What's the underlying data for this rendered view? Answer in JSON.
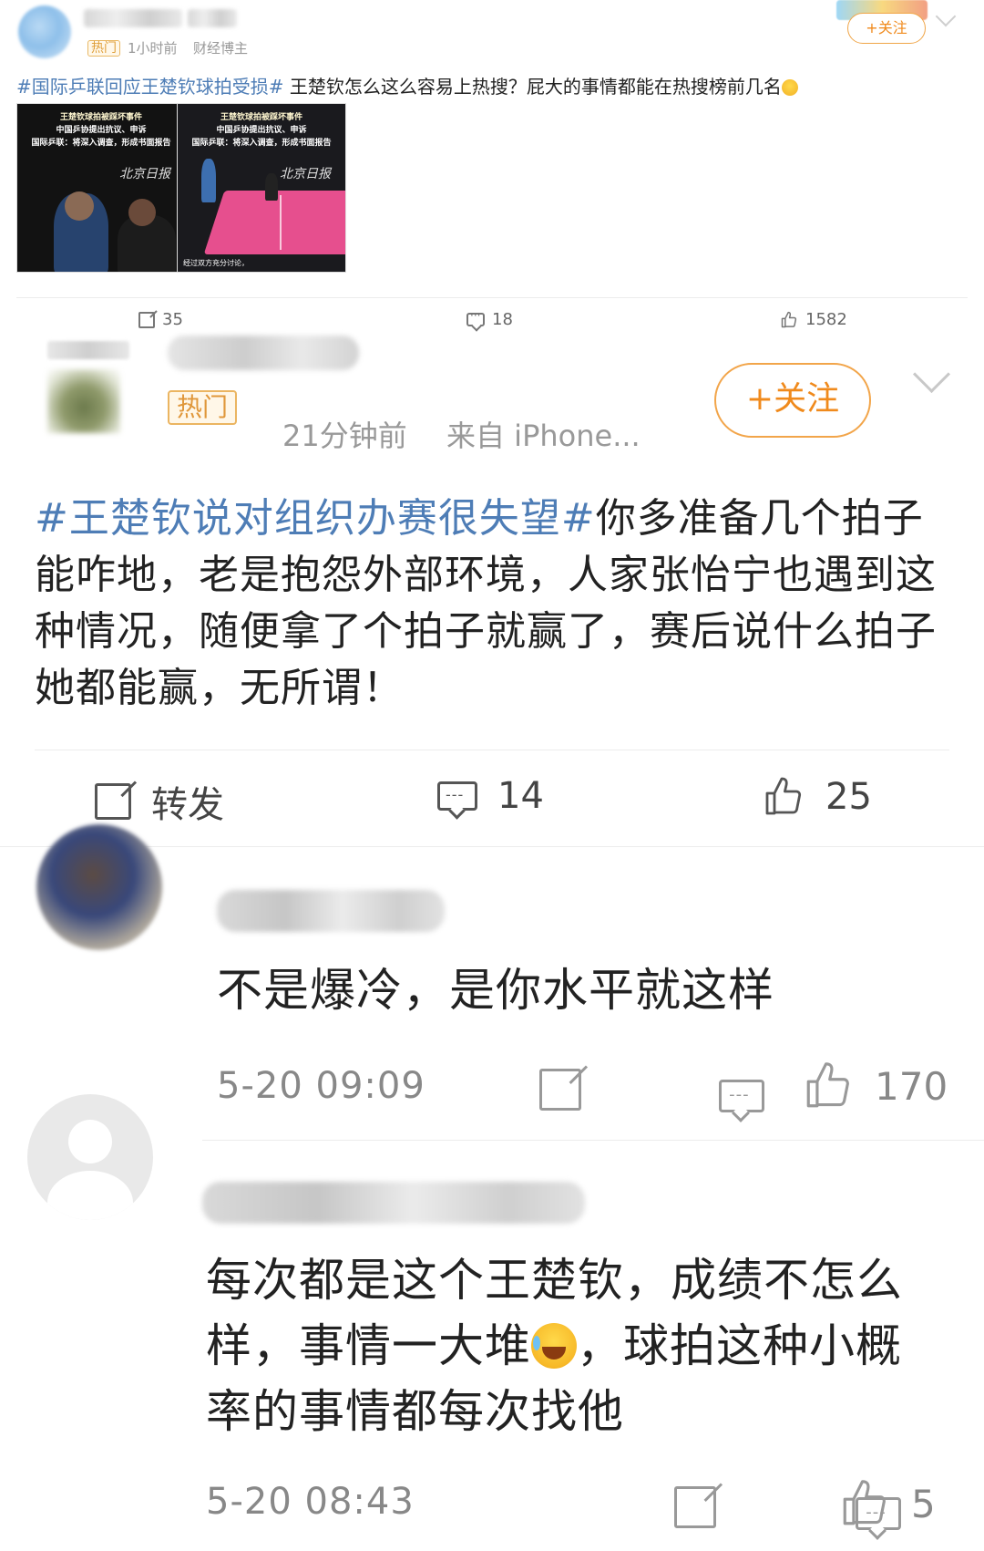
{
  "post1": {
    "hot_tag": "热门",
    "time": "1小时前",
    "author_type": "财经博主",
    "follow_label": "+关注",
    "topic": "#国际乒联回应王楚钦球拍受损#",
    "text": " 王楚钦怎么这么容易上热搜？屁大的事情都能在热搜榜前几名",
    "images": [
      {
        "headline": "王楚钦球拍被踩坏事件",
        "line2": "中国乒协提出抗议、申诉",
        "line3": "国际乒联：将深入调查，形成书面报告",
        "seal": "北京日报"
      },
      {
        "headline": "王楚钦球拍被踩坏事件",
        "line2": "中国乒协提出抗议、申诉",
        "line3": "国际乒联：将深入调查，形成书面报告",
        "seal": "北京日报",
        "caption": "经过双方充分讨论，"
      }
    ],
    "actions": {
      "share": "35",
      "comment": "18",
      "like": "1582"
    }
  },
  "post2": {
    "hot_tag": "热门",
    "time": "21分钟前",
    "source": "来自 iPhone...",
    "follow_label": "+关注",
    "topic": "#王楚钦说对组织办赛很失望#",
    "text": "你多准备几个拍子能咋地，老是抱怨外部环境，人家张怡宁也遇到这种情况，随便拿了个拍子就赢了，赛后说什么拍子她都能赢，无所谓！",
    "actions": {
      "share": "转发",
      "comment": "14",
      "like": "25"
    }
  },
  "comments": [
    {
      "text": "不是爆冷，是你水平就这样",
      "time": "5-20 09:09",
      "likes": "170"
    },
    {
      "text_before_emoji": "每次都是这个王楚钦，成绩不怎么样，事情一大堆",
      "text_after_emoji": "，球拍这种小概率的事情都每次找他",
      "time": "5-20 08:43",
      "likes": "5"
    }
  ],
  "colors": {
    "topic": "#4e7db6",
    "follow": "#f08a1c",
    "hot_tag": "#e0973a",
    "meta": "#999999"
  },
  "icons": [
    "share-icon",
    "comment-icon",
    "like-icon",
    "chevron-down-icon",
    "laugh-cry-emoji"
  ]
}
